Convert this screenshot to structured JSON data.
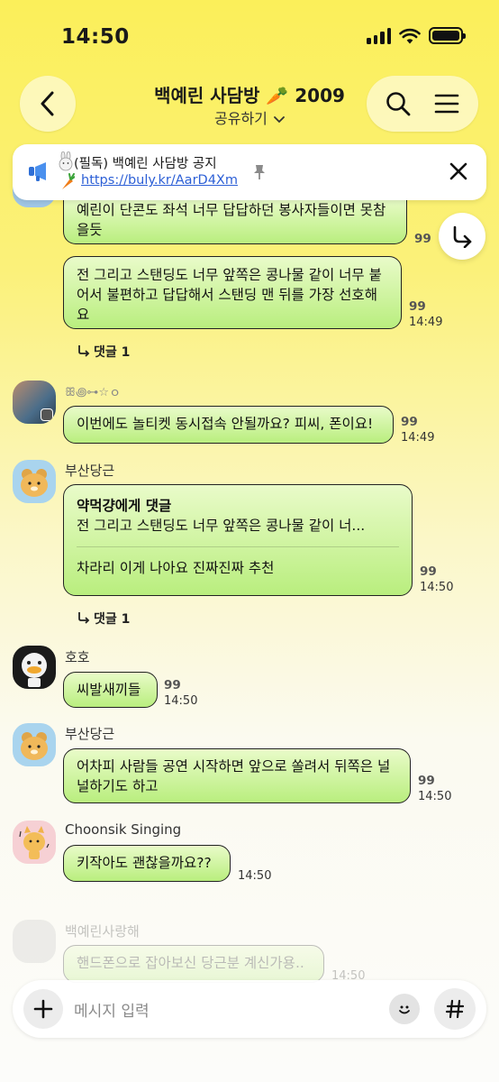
{
  "status_bar": {
    "time": "14:50"
  },
  "header": {
    "title": "백예린 사담방 🥕 2009",
    "subtitle": "공유하기"
  },
  "notice": {
    "title": "(필독) 백예린 사담방 공지",
    "link": "https://buly.kr/AarD4Xm"
  },
  "messages": {
    "m1": {
      "text": "예린이 단콘도 좌석 너무 답답하던 봉사자들이면 못참을듯",
      "unread": "99"
    },
    "m2": {
      "text": "전 그리고 스탠딩도 너무 앞쪽은 콩나물 같이 너무 붙어서 불편하고 답답해서 스탠딩 맨 뒤를 가장 선호해요",
      "unread": "99",
      "time": "14:49",
      "replies": "댓글 1"
    },
    "m3": {
      "sender": "ꕥ꩜⊶☆ｏ",
      "text": "이번에도 놀티켓 동시접속 안될까요? 피씨, 폰이요!",
      "unread": "99",
      "time": "14:49"
    },
    "m4": {
      "sender": "부산당근",
      "quote_title": "약먹걍에게 댓글",
      "quote_text": "전 그리고 스탠딩도 너무 앞쪽은 콩나물 같이 너...",
      "text": "차라리 이게 나아요 진짜진짜 추천",
      "unread": "99",
      "time": "14:50",
      "replies": "댓글 1"
    },
    "m5": {
      "sender": "호호",
      "text": "씨발새끼들",
      "unread": "99",
      "time": "14:50"
    },
    "m6": {
      "sender": "부산당근",
      "text": "어차피 사람들 공연 시작하면 앞으로 쏠려서 뒤쪽은 널널하기도 하고",
      "unread": "99",
      "time": "14:50"
    },
    "m7": {
      "sender": "Choonsik Singing",
      "text": "키작아도 괜찮을까요??",
      "time": "14:50"
    },
    "m8": {
      "sender": "백예린사랑해",
      "text": "핸드폰으로 잡아보신 당근분 계신가용..",
      "time": "14:50"
    }
  },
  "input": {
    "placeholder": "메시지 입력"
  },
  "colors": {
    "bubble_top": "#e9fbc9",
    "bubble_bottom": "#b9ee7e",
    "background_top": "#fbef5a",
    "link": "#2c5fd6"
  },
  "icons": [
    "back-arrow-icon",
    "search-icon",
    "menu-icon",
    "megaphone-icon",
    "rabbit-icon",
    "carrot-icon",
    "pin-icon",
    "close-icon",
    "scroll-down-arrow-icon",
    "reply-arrow-icon",
    "plus-icon",
    "emoji-icon",
    "hashtag-icon"
  ]
}
